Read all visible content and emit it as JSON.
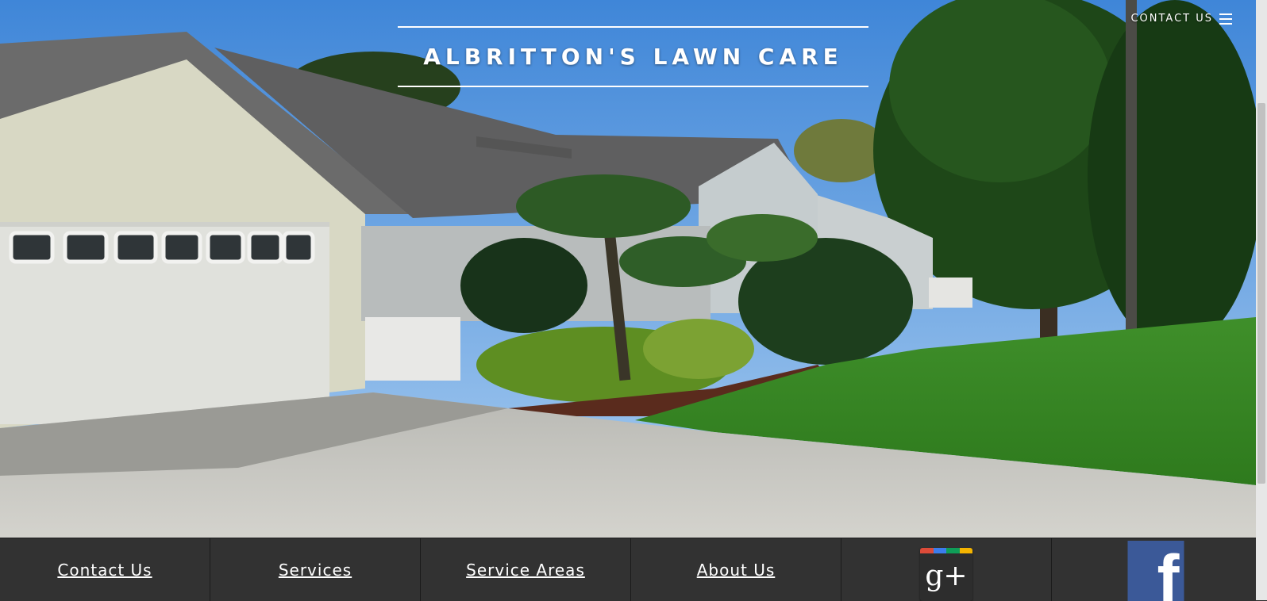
{
  "site": {
    "title": "ALBRITTON'S LAWN CARE"
  },
  "header": {
    "contact_label": "CONTACT US",
    "menu_icon": "hamburger-menu-icon"
  },
  "hero": {
    "description_icon": "house-photo"
  },
  "footer": {
    "links": [
      {
        "label": "Contact Us"
      },
      {
        "label": "Services"
      },
      {
        "label": "Service Areas"
      },
      {
        "label": "About Us"
      }
    ],
    "social": [
      {
        "icon": "google-plus-icon",
        "glyph": "g+",
        "stripe_colors": [
          "#dd4b39",
          "#3b7ded",
          "#0f9d58",
          "#f4b400"
        ]
      },
      {
        "icon": "facebook-icon",
        "glyph": "f",
        "color": "#3b5998"
      }
    ]
  },
  "colors": {
    "footer_background": "#323232",
    "link_text": "#ffffff"
  }
}
